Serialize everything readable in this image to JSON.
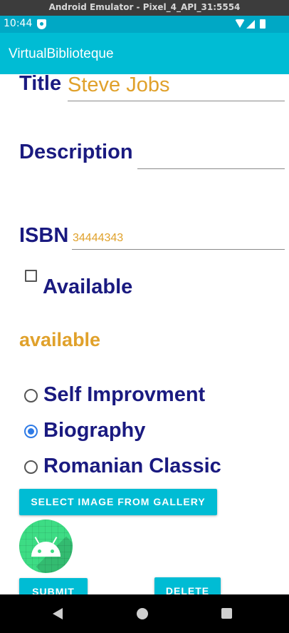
{
  "window": {
    "title": "Android Emulator - Pixel_4_API_31:5554"
  },
  "status_bar": {
    "time": "10:44"
  },
  "app_bar": {
    "title": "VirtualBiblioteque"
  },
  "form": {
    "title_label": "Title",
    "title_value": "Steve Jobs",
    "description_label": "Description",
    "description_value": "",
    "isbn_label": "ISBN",
    "isbn_value": "34444343",
    "available_checkbox_label": "Available",
    "available_checked": false,
    "availability_text": "available",
    "categories": [
      {
        "label": "Self Improvment",
        "selected": false
      },
      {
        "label": "Biography",
        "selected": true
      },
      {
        "label": "Romanian Classic",
        "selected": false
      }
    ]
  },
  "buttons": {
    "select_image": "SELECT IMAGE FROM GALLERY",
    "submit": "SUBMIT",
    "delete": "DELETE"
  },
  "image": {
    "icon": "android-icon"
  },
  "colors": {
    "app_bar": "#00bcd4",
    "status_bar": "#00a8c5",
    "label": "#1a1a80",
    "value": "#e0a12b",
    "radio_selected": "#2f7be6"
  }
}
